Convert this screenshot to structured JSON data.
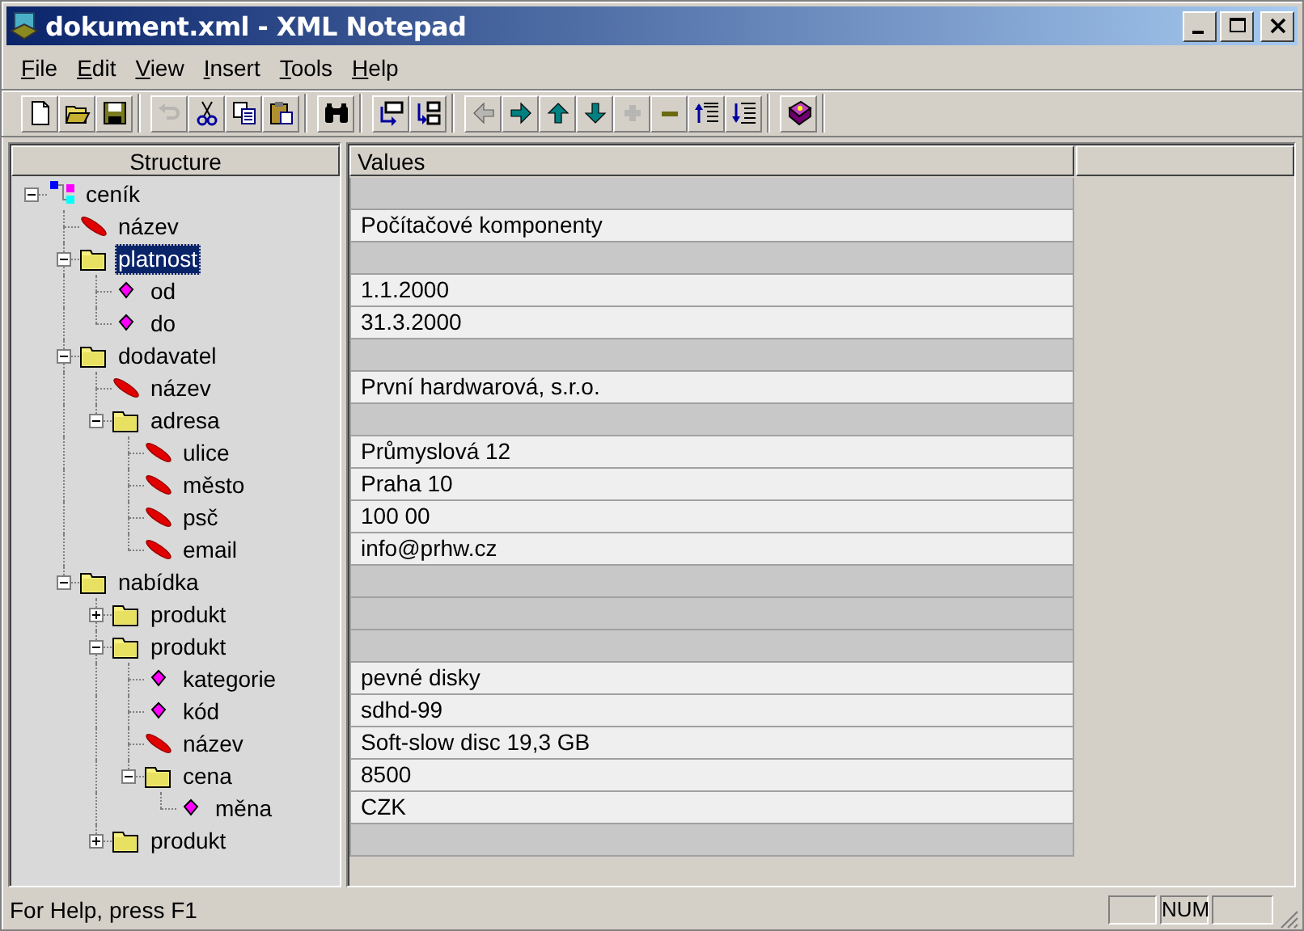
{
  "window": {
    "title": "dokument.xml - XML Notepad"
  },
  "menu": [
    "File",
    "Edit",
    "View",
    "Insert",
    "Tools",
    "Help"
  ],
  "toolbar": [
    [
      {
        "kind": "new",
        "disabled": false
      },
      {
        "kind": "open",
        "disabled": false
      },
      {
        "kind": "save",
        "disabled": false
      }
    ],
    [
      {
        "kind": "undo",
        "disabled": true
      },
      {
        "kind": "cut",
        "disabled": false
      },
      {
        "kind": "copy",
        "disabled": false
      },
      {
        "kind": "paste",
        "disabled": false
      }
    ],
    [
      {
        "kind": "find",
        "disabled": false
      }
    ],
    [
      {
        "kind": "insert-before",
        "disabled": false
      },
      {
        "kind": "insert-child",
        "disabled": false
      }
    ],
    [
      {
        "kind": "left",
        "disabled": true
      },
      {
        "kind": "right",
        "disabled": false
      },
      {
        "kind": "up",
        "disabled": false
      },
      {
        "kind": "down",
        "disabled": false
      },
      {
        "kind": "plus",
        "disabled": true
      },
      {
        "kind": "minus",
        "disabled": false
      },
      {
        "kind": "lines-up",
        "disabled": false
      },
      {
        "kind": "lines-down",
        "disabled": false
      }
    ],
    [
      {
        "kind": "help",
        "disabled": false
      }
    ]
  ],
  "columns": [
    "Structure",
    "Values"
  ],
  "tree": [
    {
      "name": "ceník",
      "kind": "root",
      "expanded": true,
      "selected": false,
      "children": [
        {
          "name": "název",
          "kind": "text",
          "selected": false,
          "value": "Počítačové komponenty"
        },
        {
          "name": "platnost",
          "kind": "folder",
          "expanded": true,
          "selected": true,
          "children": [
            {
              "name": "od",
              "kind": "attribute",
              "selected": false,
              "value": "1.1.2000"
            },
            {
              "name": "do",
              "kind": "attribute",
              "selected": false,
              "value": "31.3.2000"
            }
          ]
        },
        {
          "name": "dodavatel",
          "kind": "folder",
          "expanded": true,
          "selected": false,
          "children": [
            {
              "name": "název",
              "kind": "text",
              "selected": false,
              "value": "První hardwarová, s.r.o."
            },
            {
              "name": "adresa",
              "kind": "folder",
              "expanded": true,
              "selected": false,
              "children": [
                {
                  "name": "ulice",
                  "kind": "text",
                  "selected": false,
                  "value": "Průmyslová 12"
                },
                {
                  "name": "město",
                  "kind": "text",
                  "selected": false,
                  "value": "Praha 10"
                },
                {
                  "name": "psč",
                  "kind": "text",
                  "selected": false,
                  "value": "100 00"
                },
                {
                  "name": "email",
                  "kind": "text",
                  "selected": false,
                  "value": "info@prhw.cz"
                }
              ]
            }
          ]
        },
        {
          "name": "nabídka",
          "kind": "folder",
          "expanded": true,
          "selected": false,
          "children": [
            {
              "name": "produkt",
              "kind": "folder",
              "expanded": false,
              "selected": false
            },
            {
              "name": "produkt",
              "kind": "folder",
              "expanded": true,
              "selected": false,
              "children": [
                {
                  "name": "kategorie",
                  "kind": "attribute",
                  "selected": false,
                  "value": "pevné disky"
                },
                {
                  "name": "kód",
                  "kind": "attribute",
                  "selected": false,
                  "value": "sdhd-99"
                },
                {
                  "name": "název",
                  "kind": "text",
                  "selected": false,
                  "value": "Soft-slow disc 19,3 GB"
                },
                {
                  "name": "cena",
                  "kind": "folder",
                  "expanded": true,
                  "selected": false,
                  "value": "8500",
                  "children": [
                    {
                      "name": "měna",
                      "kind": "attribute",
                      "selected": false,
                      "value": "CZK"
                    }
                  ]
                }
              ]
            },
            {
              "name": "produkt",
              "kind": "folder",
              "expanded": false,
              "selected": false
            }
          ]
        }
      ]
    }
  ],
  "status_bar": {
    "text": "For Help, press F1",
    "panels": [
      "NUM"
    ]
  }
}
